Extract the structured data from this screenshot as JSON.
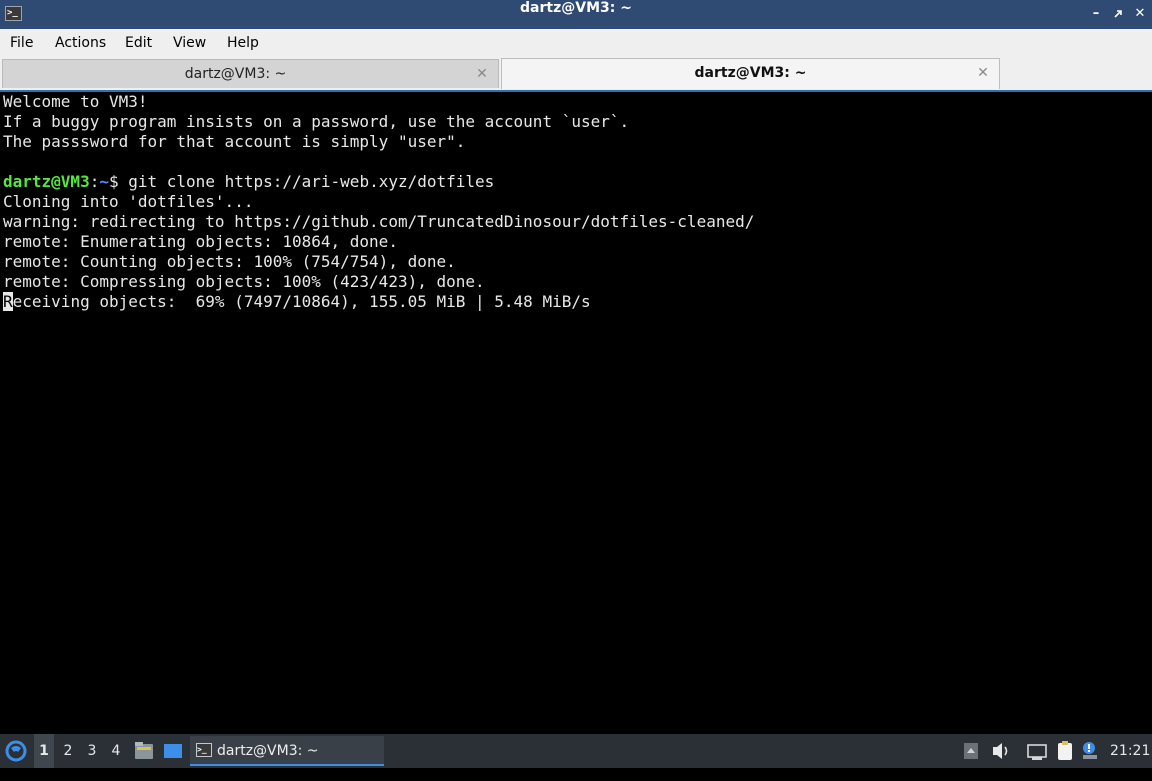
{
  "window": {
    "title": "dartz@VM3: ~",
    "app_icon": "terminal-icon",
    "controls": [
      "minimize-icon",
      "restore-icon",
      "close-icon"
    ]
  },
  "menu": {
    "items": [
      "File",
      "Actions",
      "Edit",
      "View",
      "Help"
    ]
  },
  "tabs": [
    {
      "label": "dartz@VM3: ~",
      "active": false
    },
    {
      "label": "dartz@VM3: ~",
      "active": true
    }
  ],
  "terminal": {
    "motd": [
      "Welcome to VM3!",
      "If a buggy program insists on a password, use the account `user`.",
      "The passsword for that account is simply \"user\"."
    ],
    "prompt_user": "dartz@VM3",
    "prompt_sep": ":",
    "prompt_path": "~",
    "prompt_symbol": "$ ",
    "command": "git clone https://ari-web.xyz/dotfiles",
    "output": [
      "Cloning into 'dotfiles'...",
      "warning: redirecting to https://github.com/TruncatedDinosour/dotfiles-cleaned/",
      "remote: Enumerating objects: 10864, done.",
      "remote: Counting objects: 100% (754/754), done.",
      "remote: Compressing objects: 100% (423/423), done."
    ],
    "progress_first_char": "R",
    "progress_rest": "eceiving objects:  69% (7497/10864), 155.05 MiB | 5.48 MiB/s"
  },
  "taskbar": {
    "start_icon": "start-menu-icon",
    "workspaces": [
      "1",
      "2",
      "3",
      "4"
    ],
    "active_workspace": "1",
    "launchers": [
      "file-manager-icon",
      "show-desktop-icon"
    ],
    "task": {
      "label": "dartz@VM3: ~",
      "icon": "terminal-icon"
    },
    "tray": [
      "tray-expand-icon",
      "volume-icon",
      "keyboard-icon",
      "clipboard-icon",
      "notification-icon"
    ],
    "clock": "21:21"
  }
}
